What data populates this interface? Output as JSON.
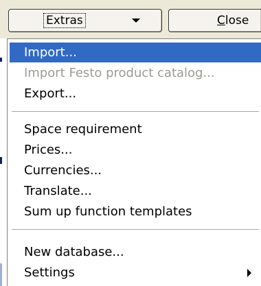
{
  "toolbar": {
    "extras_label": "Extras",
    "close_label_mnemonic": "C",
    "close_label_rest": "lose"
  },
  "menu": {
    "items": [
      {
        "label": "Import...",
        "state": "highlighted"
      },
      {
        "label": "Import Festo product catalog...",
        "state": "disabled"
      },
      {
        "label": "Export...",
        "state": "enabled"
      },
      {
        "label": "Space requirement",
        "state": "enabled"
      },
      {
        "label": "Prices...",
        "state": "enabled"
      },
      {
        "label": "Currencies...",
        "state": "enabled"
      },
      {
        "label": "Translate...",
        "state": "enabled"
      },
      {
        "label": "Sum up function templates",
        "state": "enabled"
      },
      {
        "label": "New database...",
        "state": "enabled"
      },
      {
        "label": "Settings",
        "state": "enabled",
        "has_submenu": true
      }
    ]
  },
  "colors": {
    "highlight": "#316ac5",
    "disabled_text": "#9c9a94",
    "toolbar_bg": "#ece9d8",
    "separator": "#aca899"
  }
}
